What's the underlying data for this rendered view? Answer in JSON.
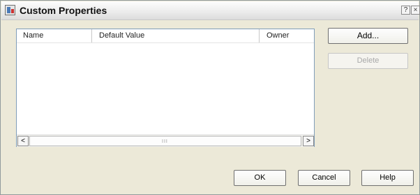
{
  "window": {
    "title": "Custom Properties",
    "help_glyph": "?",
    "close_glyph": "×"
  },
  "list": {
    "columns": [
      "Name",
      "Default Value",
      "Owner"
    ],
    "rows": []
  },
  "scrollbar": {
    "left_arrow": "<",
    "right_arrow": ">",
    "grip": "III"
  },
  "buttons": {
    "add": "Add...",
    "delete": "Delete",
    "ok": "OK",
    "cancel": "Cancel",
    "help": "Help"
  }
}
